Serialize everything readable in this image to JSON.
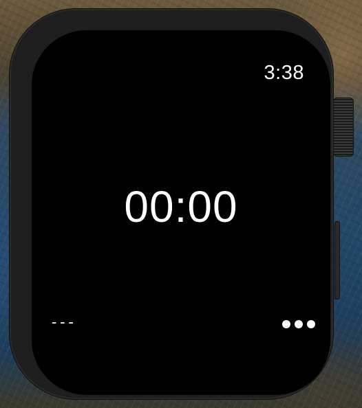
{
  "status": {
    "time": "3:38"
  },
  "timer": {
    "display": "00:00"
  },
  "footer": {
    "left_label": "---",
    "more_icon": "ellipsis-icon"
  },
  "colors": {
    "screen_background": "#000000",
    "text": "#ffffff",
    "case": "#1e1e1f"
  }
}
